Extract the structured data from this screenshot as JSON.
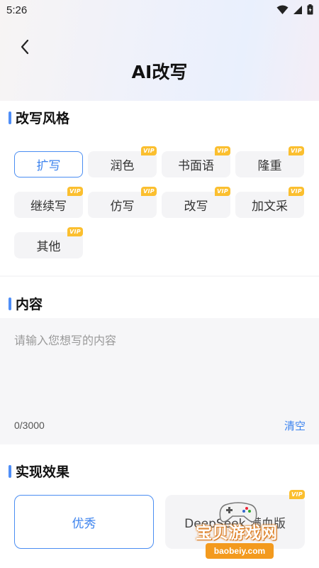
{
  "status": {
    "time": "5:26"
  },
  "header": {
    "title": "AI改写"
  },
  "style_section": {
    "title": "改写风格",
    "vip_label": "VIP",
    "chips": [
      {
        "label": "扩写"
      },
      {
        "label": "润色"
      },
      {
        "label": "书面语"
      },
      {
        "label": "隆重"
      },
      {
        "label": "继续写"
      },
      {
        "label": "仿写"
      },
      {
        "label": "改写"
      },
      {
        "label": "加文采"
      },
      {
        "label": "其他"
      }
    ]
  },
  "content_section": {
    "title": "内容",
    "placeholder": "请输入您想写的内容",
    "counter": "0/3000",
    "clear_label": "清空"
  },
  "effect_section": {
    "title": "实现效果",
    "options": [
      {
        "label": "优秀"
      },
      {
        "label": "DeepSeek 满血版"
      }
    ]
  },
  "watermark": {
    "text": "宝贝游戏网",
    "url": "baobeiy.com"
  },
  "colors": {
    "accent": "#3b82ee",
    "vip": "#fbbf2f",
    "watermark": "#f39a1e"
  }
}
